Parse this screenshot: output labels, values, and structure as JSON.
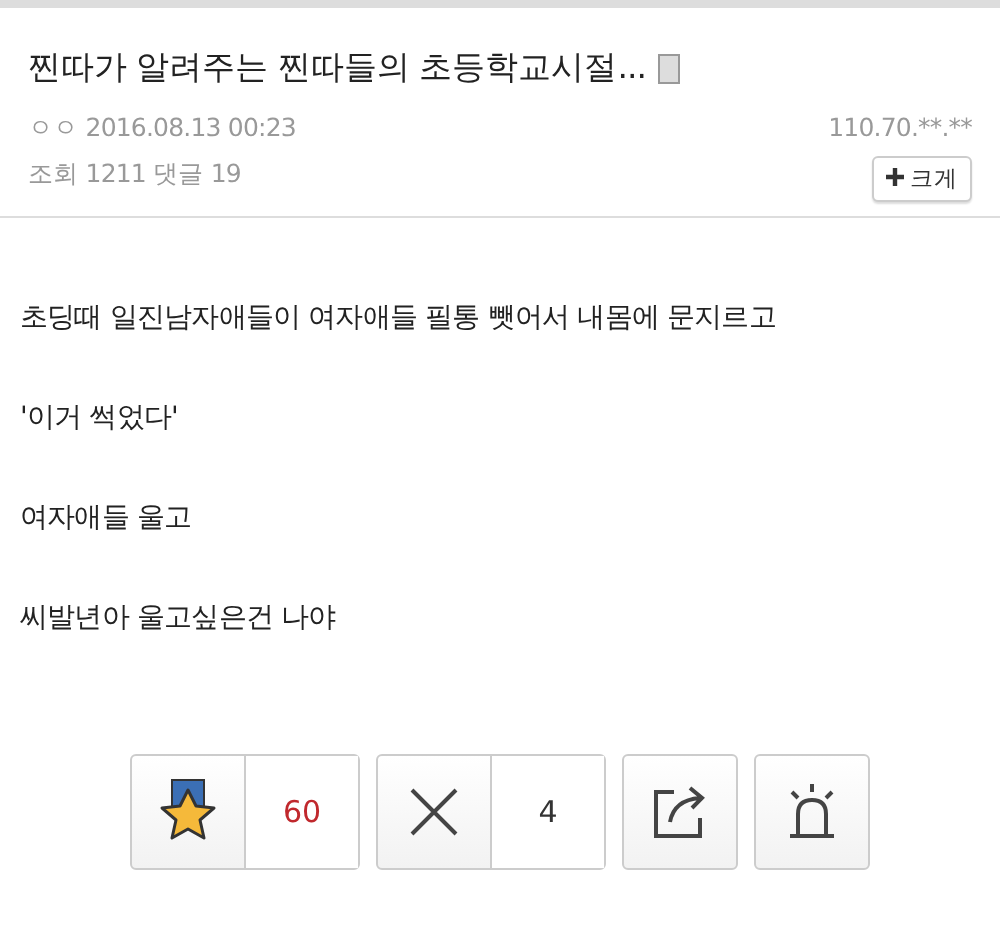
{
  "post": {
    "title": "찐따가 알려주는 찐따들의 초등학교시절...",
    "author": "ㅇㅇ",
    "date": "2016.08.13 00:23",
    "ip": "110.70.**.**",
    "views_label": "조회",
    "views": "1211",
    "comments_label": "댓글",
    "comments": "19",
    "size_button": "크게"
  },
  "body": [
    "초딩때 일진남자애들이 여자애들 필통 뺏어서 내몸에 문지르고",
    "'이거 썩었다'",
    "여자애들 울고",
    "씨발년아 울고싶은건 나야"
  ],
  "actions": [
    {
      "kind": "recommend",
      "count": "60"
    },
    {
      "kind": "unrecommend",
      "count": "4"
    },
    {
      "kind": "share"
    },
    {
      "kind": "report"
    }
  ]
}
